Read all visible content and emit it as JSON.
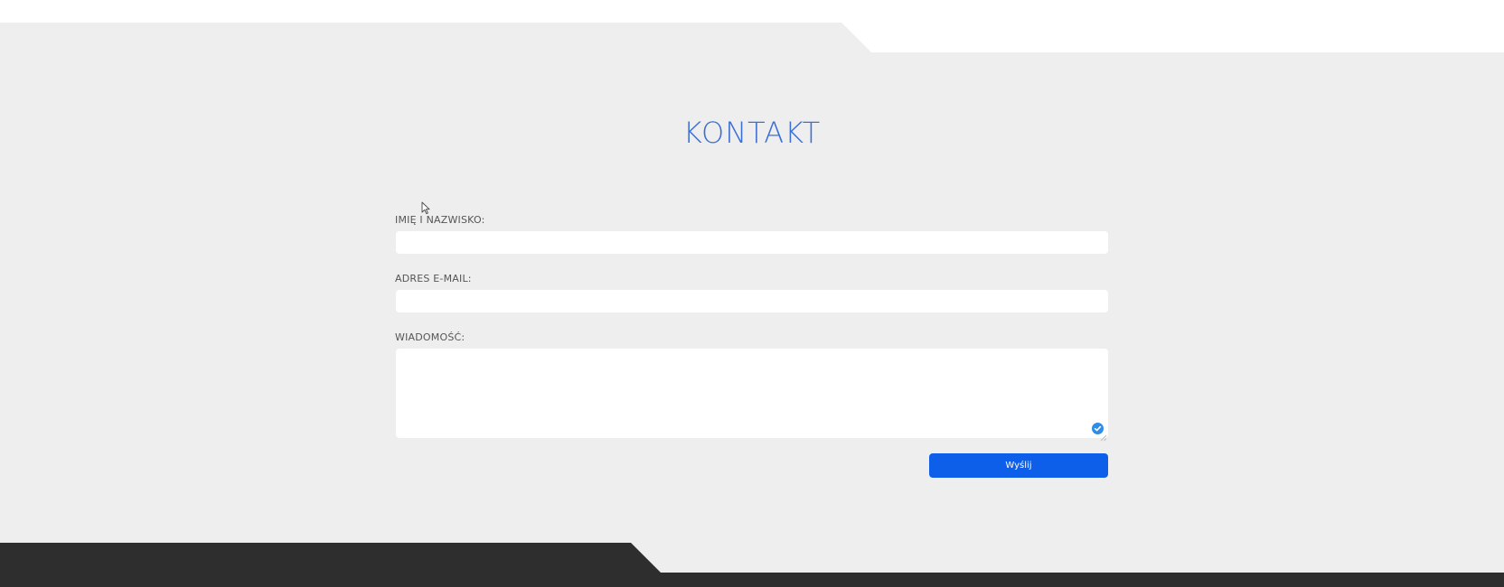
{
  "colors": {
    "page_background": "#ffffff",
    "section_background": "#eeeeee",
    "footer_background": "#2e2e2e",
    "title_color": "#3a6fd6",
    "button_color": "#0d5ee9",
    "input_background": "#ffffff"
  },
  "contact": {
    "title": "KONTAKT",
    "fields": [
      {
        "label": "IMIĘ I NAZWISKO:",
        "value": "",
        "placeholder": ""
      },
      {
        "label": "ADRES E-MAIL:",
        "value": "",
        "placeholder": ""
      },
      {
        "label": "WIADOMOŚĆ:",
        "value": "",
        "placeholder": ""
      }
    ],
    "submit_label": "Wyślij"
  },
  "icons": {
    "grammar_check": "grammar-check-icon",
    "cursor": "mouse-cursor-icon",
    "resize": "resize-handle-icon"
  }
}
